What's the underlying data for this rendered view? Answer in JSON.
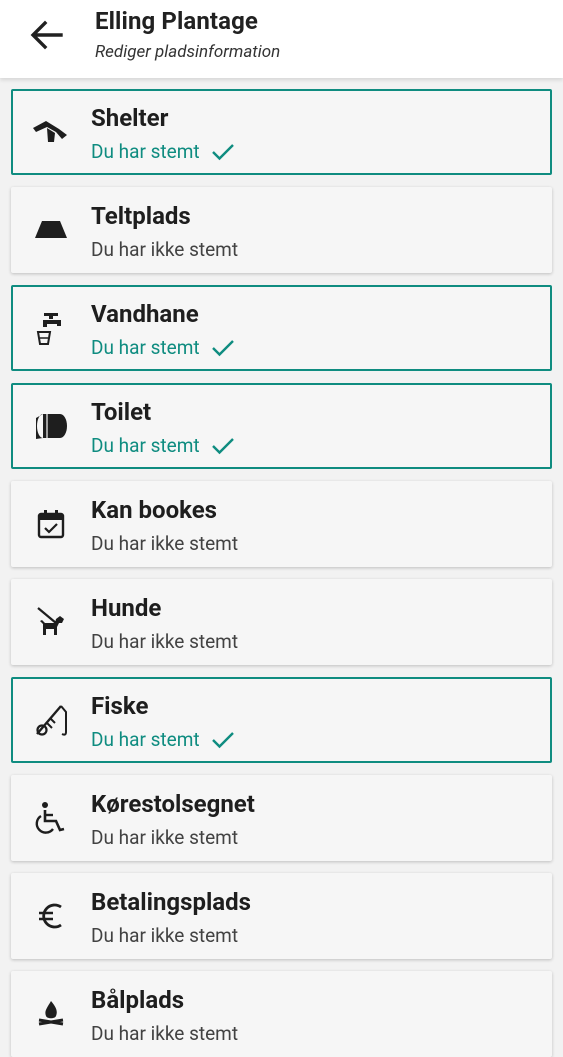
{
  "header": {
    "title": "Elling Plantage",
    "subtitle": "Rediger pladsinformation"
  },
  "colors": {
    "accent": "#0f8c80",
    "text": "#212121",
    "background": "#f2f2f2"
  },
  "facilities": [
    {
      "name": "Shelter",
      "status": "Du har stemt",
      "voted": true,
      "icon": "shelter-icon"
    },
    {
      "name": "Teltplads",
      "status": "Du har ikke stemt",
      "voted": false,
      "icon": "tent-icon"
    },
    {
      "name": "Vandhane",
      "status": "Du har stemt",
      "voted": true,
      "icon": "water-tap-icon"
    },
    {
      "name": "Toilet",
      "status": "Du har stemt",
      "voted": true,
      "icon": "toilet-paper-icon"
    },
    {
      "name": "Kan bookes",
      "status": "Du har ikke stemt",
      "voted": false,
      "icon": "calendar-check-icon"
    },
    {
      "name": "Hunde",
      "status": "Du har ikke stemt",
      "voted": false,
      "icon": "dog-icon"
    },
    {
      "name": "Fiske",
      "status": "Du har stemt",
      "voted": true,
      "icon": "fishing-rod-icon"
    },
    {
      "name": "Kørestolsegnet",
      "status": "Du har ikke stemt",
      "voted": false,
      "icon": "wheelchair-icon"
    },
    {
      "name": "Betalingsplads",
      "status": "Du har ikke stemt",
      "voted": false,
      "icon": "euro-icon"
    },
    {
      "name": "Bålplads",
      "status": "Du har ikke stemt",
      "voted": false,
      "icon": "campfire-icon"
    }
  ]
}
